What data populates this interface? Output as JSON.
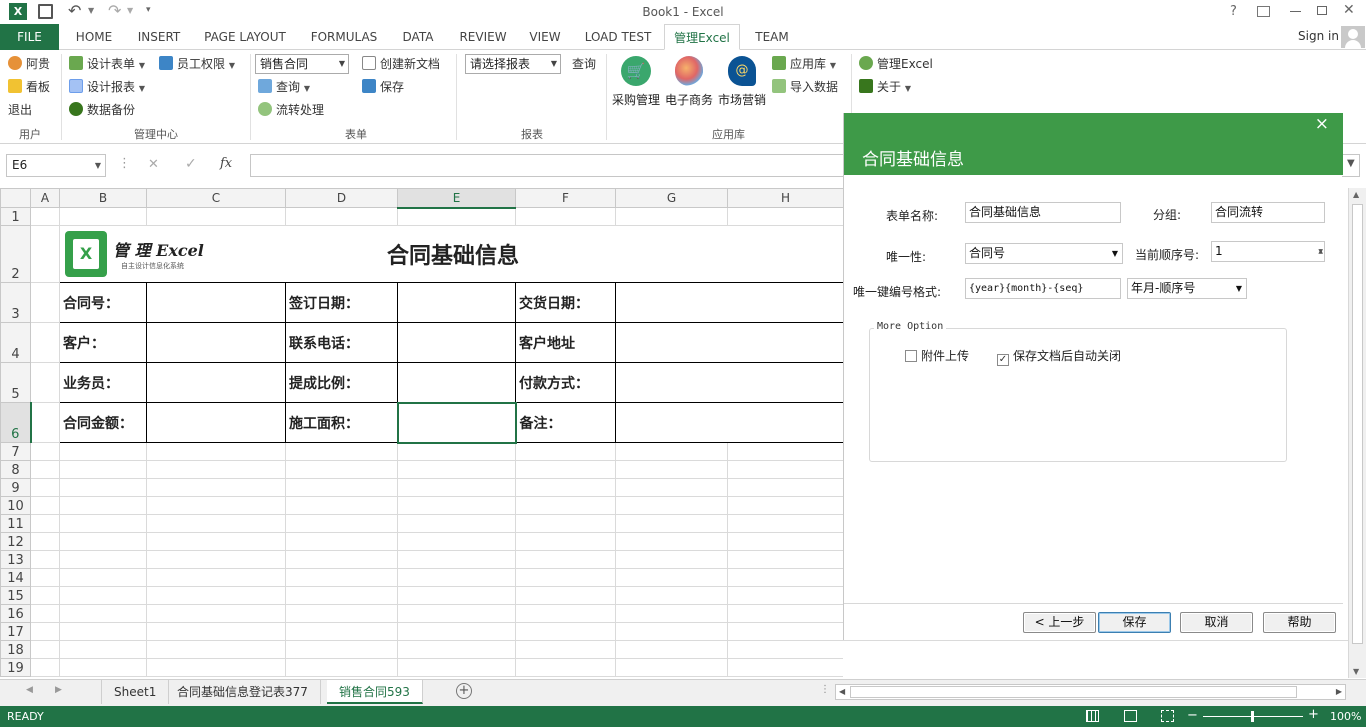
{
  "window": {
    "title": "Book1 - Excel",
    "help": "?",
    "sign_in": "Sign in"
  },
  "tabs": [
    "FILE",
    "HOME",
    "INSERT",
    "PAGE LAYOUT",
    "FORMULAS",
    "DATA",
    "REVIEW",
    "VIEW",
    "LOAD TEST",
    "管理Excel",
    "TEAM"
  ],
  "ribbon": {
    "user": {
      "name": "阿贵",
      "board": "看板",
      "exit": "退出",
      "group": "用户"
    },
    "mgmt": {
      "design_form": "设计表单",
      "perms": "员工权限",
      "design_report": "设计报表",
      "backup": "数据备份",
      "group": "管理中心"
    },
    "form": {
      "combo": "销售合同",
      "new_doc": "创建新文档",
      "query": "查询",
      "save": "保存",
      "flow": "流转处理",
      "group": "表单"
    },
    "report": {
      "combo": "请选择报表",
      "query": "查询",
      "group": "报表"
    },
    "apps": {
      "purchase": "采购管理",
      "ecommerce": "电子商务",
      "marketing": "市场营销",
      "app_store": "应用库",
      "import": "导入数据",
      "group": "应用库"
    },
    "about": {
      "manage": "管理Excel",
      "about": "关于"
    }
  },
  "formula_bar": {
    "name_box": "E6",
    "fx": "fx",
    "cancel": "✕",
    "enter": "✓",
    "value": ""
  },
  "grid": {
    "columns": [
      "A",
      "B",
      "C",
      "D",
      "E",
      "F",
      "G",
      "H"
    ],
    "rows": [
      "1",
      "2",
      "3",
      "4",
      "5",
      "6",
      "7",
      "8",
      "9",
      "10",
      "11",
      "12",
      "13",
      "14",
      "15",
      "16",
      "17",
      "18",
      "19"
    ],
    "logo_text": "管 理 Excel",
    "logo_sub": "自主设计信息化系统",
    "form_title": "合同基础信息",
    "r3": [
      "合同号：",
      "签订日期：",
      "交货日期："
    ],
    "r4": [
      "客户：",
      "联系电话：",
      "客户地址"
    ],
    "r5": [
      "业务员：",
      "提成比例：",
      "付款方式："
    ],
    "r6": [
      "合同金额：",
      "施工面积：",
      "备注："
    ]
  },
  "sheets": [
    "Sheet1",
    "合同基础信息登记表377",
    "销售合同593"
  ],
  "status": {
    "ready": "READY",
    "zoom": "100%"
  },
  "panel": {
    "title": "合同基础信息",
    "close": "×",
    "form_name_label": "表单名称:",
    "form_name": "合同基础信息",
    "group_label": "分组:",
    "group": "合同流转",
    "unique_label": "唯一性:",
    "unique": "合同号",
    "seq_label": "当前顺序号:",
    "seq": "1",
    "key_format_label": "唯一键编号格式:",
    "key_format": "{year}{month}-{seq}",
    "key_format_sel": "年月-顺序号",
    "more_option": "More Option",
    "attach_label": "附件上传",
    "attach_checked": false,
    "autoclose_label": "保存文档后自动关闭",
    "autoclose_checked": true,
    "prev_btn": "< 上一步",
    "save_btn": "保存",
    "cancel_btn": "取消",
    "help_btn": "帮助"
  }
}
